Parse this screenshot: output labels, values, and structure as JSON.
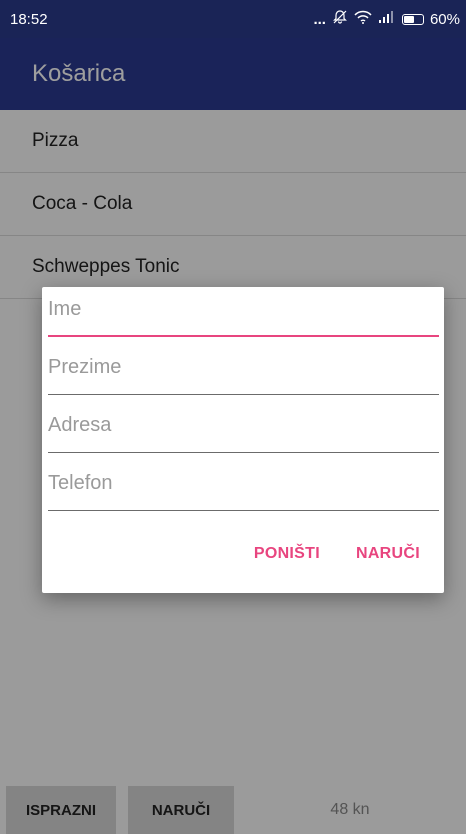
{
  "status_bar": {
    "time": "18:52",
    "dots": "...",
    "battery_text": "60%",
    "battery_level": 0.6
  },
  "app_bar": {
    "title": "Košarica"
  },
  "cart": {
    "items": [
      {
        "name": "Pizza"
      },
      {
        "name": "Coca - Cola"
      },
      {
        "name": "Schweppes Tonic"
      }
    ]
  },
  "bottom_bar": {
    "empty_label": "ISPRAZNI",
    "order_label": "NARUČI",
    "total": "48 kn"
  },
  "dialog": {
    "fields": [
      {
        "placeholder": "Ime",
        "value": ""
      },
      {
        "placeholder": "Prezime",
        "value": ""
      },
      {
        "placeholder": "Adresa",
        "value": ""
      },
      {
        "placeholder": "Telefon",
        "value": ""
      }
    ],
    "cancel_label": "PONIŠTI",
    "confirm_label": "NARUČI"
  },
  "colors": {
    "status_bar": "#1a2456",
    "app_bar": "#2a3990",
    "accent": "#e8457f"
  },
  "icons": [
    "bell-off-icon",
    "wifi-icon",
    "signal-icon",
    "battery-icon"
  ]
}
